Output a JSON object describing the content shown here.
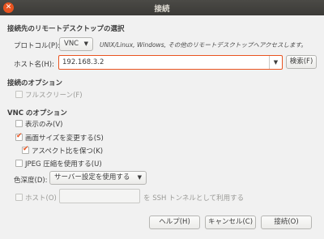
{
  "window": {
    "title": "接続",
    "close_icon": "✕"
  },
  "connection": {
    "heading": "接続先のリモートデスクトップの選択",
    "protocol_label": "プロトコル(P):",
    "protocol_value": "VNC",
    "protocol_note": "UNIX/Linux, Windows, その他のリモートデスクトップへアクセスします。",
    "host_label": "ホスト名(H):",
    "host_value": "192.168.3.2",
    "search_label": "検索(F)"
  },
  "connection_options": {
    "heading": "接続のオプション",
    "fullscreen_label": "フルスクリーン(F)",
    "fullscreen_checked": false
  },
  "vnc_options": {
    "heading": "VNC のオプション",
    "view_only_label": "表示のみ(V)",
    "view_only_checked": false,
    "resize_label": "画面サイズを変更する(S)",
    "resize_checked": true,
    "aspect_label": "アスペクト比を保つ(K)",
    "aspect_checked": true,
    "jpeg_label": "JPEG 圧縮を使用する(U)",
    "jpeg_checked": false,
    "color_depth_label": "色深度(D):",
    "color_depth_value": "サーバー設定を使用する",
    "ssh_host_label": "ホスト(O)",
    "ssh_host_value": "",
    "ssh_suffix": "を SSH トンネルとして利用する"
  },
  "buttons": {
    "help": "ヘルプ(H)",
    "cancel": "キャンセル(C)",
    "connect": "接続(O)"
  },
  "colors": {
    "accent": "#e95420",
    "titlebar": "#3b3a37",
    "background": "#f1f1f1"
  }
}
